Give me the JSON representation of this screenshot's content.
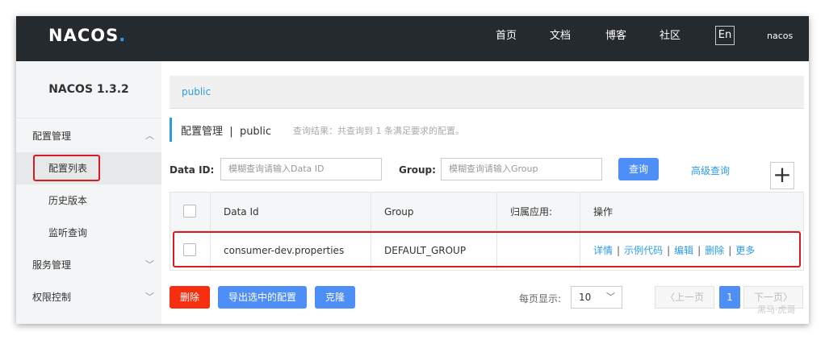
{
  "header": {
    "logo": "NACOS",
    "logo_dot": ".",
    "nav": [
      "首页",
      "文档",
      "博客",
      "社区"
    ],
    "lang": "En",
    "user": "nacos"
  },
  "sidebar": {
    "brand": "NACOS 1.3.2",
    "groups": [
      {
        "label": "配置管理",
        "chevron": "up"
      },
      {
        "label": "配置列表"
      },
      {
        "label": "历史版本"
      },
      {
        "label": "监听查询"
      },
      {
        "label": "服务管理",
        "chevron": "down"
      },
      {
        "label": "权限控制",
        "chevron": "down"
      }
    ]
  },
  "breadcrumb": {
    "namespace": "public"
  },
  "page": {
    "title": "配置管理",
    "divider": "|",
    "namespace": "public",
    "result": "查询结果：共查询到 1 条满足要求的配置。"
  },
  "search": {
    "data_id_label": "Data ID:",
    "data_id_placeholder": "模糊查询请输入Data ID",
    "group_label": "Group:",
    "group_placeholder": "模糊查询请输入Group",
    "query_button": "查询",
    "advanced_link": "高级查询",
    "add_button": "+"
  },
  "table": {
    "columns": [
      "Data Id",
      "Group",
      "归属应用:",
      "操作"
    ],
    "rows": [
      {
        "data_id": "consumer-dev.properties",
        "group": "DEFAULT_GROUP",
        "app": "",
        "ops": [
          "详情",
          "示例代码",
          "编辑",
          "删除",
          "更多"
        ]
      }
    ]
  },
  "footer": {
    "delete_button": "删除",
    "export_button": "导出选中的配置",
    "clone_button": "克隆",
    "page_size_label": "每页显示:",
    "page_size": "10",
    "prev": "上一页",
    "current_page": "1",
    "next": "下一页"
  },
  "watermark": "黑马·虎哥",
  "colors": {
    "accent": "#2d9be8",
    "primary_button": "#4e8ef7",
    "danger_button": "#f52f0f",
    "highlight_box": "#d71b20",
    "header_bg": "#252a2f"
  }
}
